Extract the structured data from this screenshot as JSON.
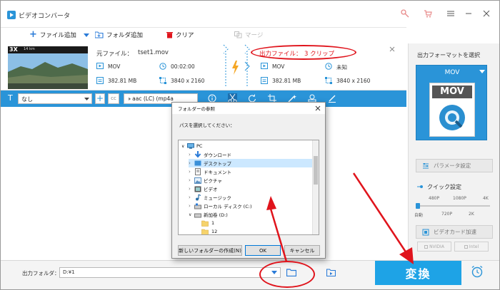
{
  "window": {
    "title": "ビデオコンバータ"
  },
  "toolbar": {
    "add_file": "ファイル追加",
    "add_folder": "フォルダ追加",
    "clear": "クリア",
    "merge": "マージ"
  },
  "video": {
    "thumb_caption": "3X",
    "thumb_caption2": "14 km",
    "source_label": "元ファイル：",
    "source_name": "tset1.mov",
    "src_format": "MOV",
    "src_duration": "00:02:00",
    "src_size": "382.81 MB",
    "src_resolution": "3840 x 2160",
    "output_label": "出力ファイル：",
    "output_clips": "3 クリップ",
    "out_format": "MOV",
    "out_duration": "未知",
    "out_size": "382.81 MB",
    "out_resolution": "3840 x 2160"
  },
  "editbar": {
    "subtitle": "なし",
    "cc": "cc",
    "audio": "aac (LC) (mp4a"
  },
  "right_panel": {
    "heading": "出力フォーマットを選択",
    "format": "MOV",
    "format_icon_text": "MOV",
    "param_button": "パラメータ設定",
    "quick_label": "クイック設定",
    "quality_top": [
      "480P",
      "1080P",
      "4K"
    ],
    "quality_bottom": [
      "自動",
      "720P",
      "2K"
    ],
    "gpu_button": "ビデオカード加速",
    "gpu_vendors": [
      "NVIDIA",
      "Intel"
    ]
  },
  "bottom": {
    "folder_label": "出力フォルダ：",
    "folder_value": "D:¥1",
    "convert": "変換"
  },
  "dialog": {
    "title": "フォルダーの参照",
    "prompt": "パスを選択してください：",
    "tree": [
      "PC",
      "ダウンロード",
      "デスクトップ",
      "ドキュメント",
      "ピクチャ",
      "ビデオ",
      "ミュージック",
      "ローカル ディスク (C:)",
      "新加卷 (D:)",
      "1",
      "12"
    ],
    "new_folder": "新しいフォルダーの作成(N)",
    "ok": "OK",
    "cancel": "キャンセル"
  },
  "colors": {
    "accent": "#2a94d8",
    "convert": "#1ea3e6",
    "annotation": "#e0141c",
    "orange": "#f5a623"
  }
}
